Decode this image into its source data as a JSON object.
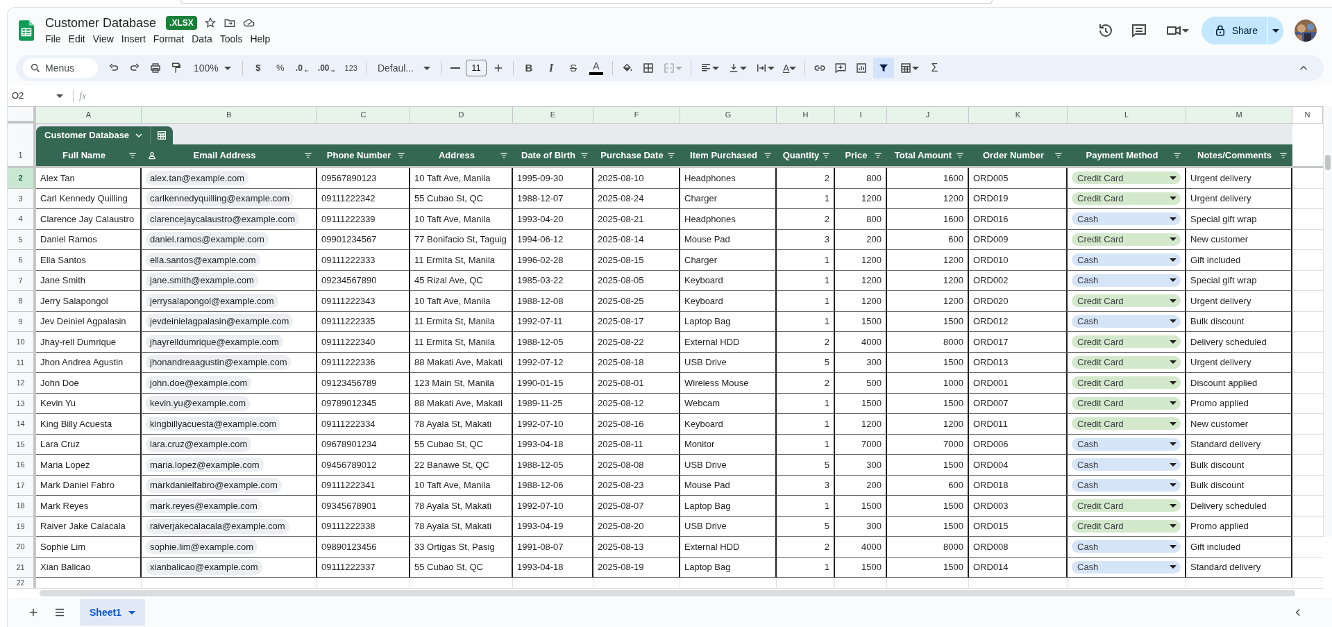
{
  "document": {
    "title": "Customer Database",
    "badge": ".XLSX"
  },
  "menu": [
    "File",
    "Edit",
    "View",
    "Insert",
    "Format",
    "Data",
    "Tools",
    "Help"
  ],
  "share": {
    "label": "Share"
  },
  "toolbar": {
    "search_label": "Menus",
    "zoom": "100%",
    "currency": "$",
    "percent": "%",
    "decrease_decimals": ".0",
    "increase_decimals": ".00",
    "number_format": "123",
    "font": "Defaul...",
    "font_size": "11",
    "bold": "B",
    "italic": "I",
    "strikethrough": "S",
    "text_color": "A",
    "rotate": "A",
    "functions": "Σ",
    "filter_on": true
  },
  "name_box": "O2",
  "formula_label": "fx",
  "column_letters": [
    {
      "letter": "A",
      "highlighted": true
    },
    {
      "letter": "B",
      "highlighted": true
    },
    {
      "letter": "C",
      "highlighted": true
    },
    {
      "letter": "D",
      "highlighted": true
    },
    {
      "letter": "E",
      "highlighted": true
    },
    {
      "letter": "F",
      "highlighted": true
    },
    {
      "letter": "G",
      "highlighted": true
    },
    {
      "letter": "H",
      "highlighted": true
    },
    {
      "letter": "I",
      "highlighted": true
    },
    {
      "letter": "J",
      "highlighted": true
    },
    {
      "letter": "K",
      "highlighted": true
    },
    {
      "letter": "L",
      "highlighted": true
    },
    {
      "letter": "M",
      "highlighted": true
    },
    {
      "letter": "N",
      "highlighted": false
    }
  ],
  "table": {
    "name": "Customer Database",
    "header_row_number": "1",
    "columns": [
      {
        "header": "Full Name",
        "kind": "text"
      },
      {
        "header": "Email Address",
        "kind": "email"
      },
      {
        "header": "Phone Number",
        "kind": "text"
      },
      {
        "header": "Address",
        "kind": "text"
      },
      {
        "header": "Date of Birth",
        "kind": "text"
      },
      {
        "header": "Purchase Date",
        "kind": "text"
      },
      {
        "header": "Item Purchased",
        "kind": "text"
      },
      {
        "header": "Quantity",
        "kind": "number"
      },
      {
        "header": "Price",
        "kind": "number"
      },
      {
        "header": "Total Amount",
        "kind": "number"
      },
      {
        "header": "Order Number",
        "kind": "text"
      },
      {
        "header": "Payment Method",
        "kind": "choice"
      },
      {
        "header": "Notes/Comments",
        "kind": "text"
      }
    ],
    "rows": [
      {
        "number": "2",
        "selected": true,
        "cells": [
          "Alex Tan",
          "alex.tan@example.com",
          "09567890123",
          "10 Taft Ave, Manila",
          "1995-09-30",
          "2025-08-10",
          "Headphones",
          "2",
          "800",
          "1600",
          "ORD005",
          "Credit Card",
          "Urgent delivery"
        ],
        "color": "#d4e8cc"
      },
      {
        "number": "3",
        "selected": false,
        "cells": [
          "Carl Kennedy Quilling",
          "carlkennedyquilling@example.com",
          "09111222342",
          "55 Cubao St, QC",
          "1988-12-07",
          "2025-08-24",
          "Charger",
          "1",
          "1200",
          "1200",
          "ORD019",
          "Credit Card",
          "Urgent delivery"
        ],
        "color": "#d4e8cc"
      },
      {
        "number": "4",
        "selected": false,
        "cells": [
          "Clarence Jay Calaustro",
          "clarencejaycalaustro@example.com",
          "09111222339",
          "10 Taft Ave, Manila",
          "1993-04-20",
          "2025-08-21",
          "Headphones",
          "2",
          "800",
          "1600",
          "ORD016",
          "Cash",
          "Special gift wrap"
        ],
        "color": "#d6e4f8"
      },
      {
        "number": "5",
        "selected": false,
        "cells": [
          "Daniel Ramos",
          "daniel.ramos@example.com",
          "09901234567",
          "77 Bonifacio St, Taguig",
          "1994-06-12",
          "2025-08-14",
          "Mouse Pad",
          "3",
          "200",
          "600",
          "ORD009",
          "Credit Card",
          "New customer"
        ],
        "color": "#d4e8cc"
      },
      {
        "number": "6",
        "selected": false,
        "cells": [
          "Ella Santos",
          "ella.santos@example.com",
          "09111222333",
          "11 Ermita St, Manila",
          "1996-02-28",
          "2025-08-15",
          "Charger",
          "1",
          "1200",
          "1200",
          "ORD010",
          "Cash",
          "Gift included"
        ],
        "color": "#d6e4f8"
      },
      {
        "number": "7",
        "selected": false,
        "cells": [
          "Jane Smith",
          "jane.smith@example.com",
          "09234567890",
          "45 Rizal Ave, QC",
          "1985-03-22",
          "2025-08-05",
          "Keyboard",
          "1",
          "1200",
          "1200",
          "ORD002",
          "Cash",
          "Special gift wrap"
        ],
        "color": "#d6e4f8"
      },
      {
        "number": "8",
        "selected": false,
        "cells": [
          "Jerry Salapongol",
          "jerrysalapongol@example.com",
          "09111222343",
          "10 Taft Ave, Manila",
          "1988-12-08",
          "2025-08-25",
          "Keyboard",
          "1",
          "1200",
          "1200",
          "ORD020",
          "Credit Card",
          "Urgent delivery"
        ],
        "color": "#d4e8cc"
      },
      {
        "number": "9",
        "selected": false,
        "cells": [
          "Jev Deiniel Agpalasin",
          "jevdeinielagpalasin@example.com",
          "09111222335",
          "11 Ermita St, Manila",
          "1992-07-11",
          "2025-08-17",
          "Laptop Bag",
          "1",
          "1500",
          "1500",
          "ORD012",
          "Cash",
          "Bulk discount"
        ],
        "color": "#d6e4f8"
      },
      {
        "number": "10",
        "selected": false,
        "cells": [
          "Jhay-rell Dumrique",
          "jhayrelldumrique@example.com",
          "09111222340",
          "11 Ermita St, Manila",
          "1988-12-05",
          "2025-08-22",
          "External HDD",
          "2",
          "4000",
          "8000",
          "ORD017",
          "Credit Card",
          "Delivery scheduled"
        ],
        "color": "#d4e8cc"
      },
      {
        "number": "11",
        "selected": false,
        "cells": [
          "Jhon Andrea Agustin",
          "jhonandreaagustin@example.com",
          "09111222336",
          "88 Makati Ave, Makati",
          "1992-07-12",
          "2025-08-18",
          "USB Drive",
          "5",
          "300",
          "1500",
          "ORD013",
          "Credit Card",
          "Urgent delivery"
        ],
        "color": "#d4e8cc"
      },
      {
        "number": "12",
        "selected": false,
        "cells": [
          "John Doe",
          "john.doe@example.com",
          "09123456789",
          "123 Main St, Manila",
          "1990-01-15",
          "2025-08-01",
          "Wireless Mouse",
          "2",
          "500",
          "1000",
          "ORD001",
          "Credit Card",
          "Discount applied"
        ],
        "color": "#d4e8cc"
      },
      {
        "number": "13",
        "selected": false,
        "cells": [
          "Kevin Yu",
          "kevin.yu@example.com",
          "09789012345",
          "88 Makati Ave, Makati",
          "1989-11-25",
          "2025-08-12",
          "Webcam",
          "1",
          "1500",
          "1500",
          "ORD007",
          "Credit Card",
          "Promo applied"
        ],
        "color": "#d4e8cc"
      },
      {
        "number": "14",
        "selected": false,
        "cells": [
          "King Billy Acuesta",
          "kingbillyacuesta@example.com",
          "09111222334",
          "78 Ayala St, Makati",
          "1992-07-10",
          "2025-08-16",
          "Keyboard",
          "1",
          "1200",
          "1200",
          "ORD011",
          "Credit Card",
          "New customer"
        ],
        "color": "#d4e8cc"
      },
      {
        "number": "15",
        "selected": false,
        "cells": [
          "Lara Cruz",
          "lara.cruz@example.com",
          "09678901234",
          "55 Cubao St, QC",
          "1993-04-18",
          "2025-08-11",
          "Monitor",
          "1",
          "7000",
          "7000",
          "ORD006",
          "Cash",
          "Standard delivery"
        ],
        "color": "#d6e4f8"
      },
      {
        "number": "16",
        "selected": false,
        "cells": [
          "Maria Lopez",
          "maria.lopez@example.com",
          "09456789012",
          "22 Banawe St, QC",
          "1988-12-05",
          "2025-08-08",
          "USB Drive",
          "5",
          "300",
          "1500",
          "ORD004",
          "Cash",
          "Bulk discount"
        ],
        "color": "#d6e4f8"
      },
      {
        "number": "17",
        "selected": false,
        "cells": [
          "Mark Daniel Fabro",
          "markdanielfabro@example.com",
          "09111222341",
          "10 Taft Ave, Manila",
          "1988-12-06",
          "2025-08-23",
          "Mouse Pad",
          "3",
          "200",
          "600",
          "ORD018",
          "Cash",
          "Bulk discount"
        ],
        "color": "#d6e4f8"
      },
      {
        "number": "18",
        "selected": false,
        "cells": [
          "Mark Reyes",
          "mark.reyes@example.com",
          "09345678901",
          "78 Ayala St, Makati",
          "1992-07-10",
          "2025-08-07",
          "Laptop Bag",
          "1",
          "1500",
          "1500",
          "ORD003",
          "Credit Card",
          "Delivery scheduled"
        ],
        "color": "#d4e8cc"
      },
      {
        "number": "19",
        "selected": false,
        "cells": [
          "Raiver Jake Calacala",
          "raiverjakecalacala@example.com",
          "09111222338",
          "78 Ayala St, Makati",
          "1993-04-19",
          "2025-08-20",
          "USB Drive",
          "5",
          "300",
          "1500",
          "ORD015",
          "Credit Card",
          "Promo applied"
        ],
        "color": "#d4e8cc"
      },
      {
        "number": "20",
        "selected": false,
        "cells": [
          "Sophie Lim",
          "sophie.lim@example.com",
          "09890123456",
          "33 Ortigas St, Pasig",
          "1991-08-07",
          "2025-08-13",
          "External HDD",
          "2",
          "4000",
          "8000",
          "ORD008",
          "Cash",
          "Gift included"
        ],
        "color": "#d6e4f8"
      },
      {
        "number": "21",
        "selected": false,
        "cells": [
          "Xian Balicao",
          "xianbalicao@example.com",
          "09111222337",
          "55 Cubao St, QC",
          "1993-04-18",
          "2025-08-19",
          "Laptop Bag",
          "1",
          "1500",
          "1500",
          "ORD014",
          "Cash",
          "Standard delivery"
        ],
        "color": "#d6e4f8"
      }
    ]
  },
  "empty_row_number": "22",
  "sheets": [
    {
      "name": "Sheet1",
      "selected": true
    }
  ]
}
